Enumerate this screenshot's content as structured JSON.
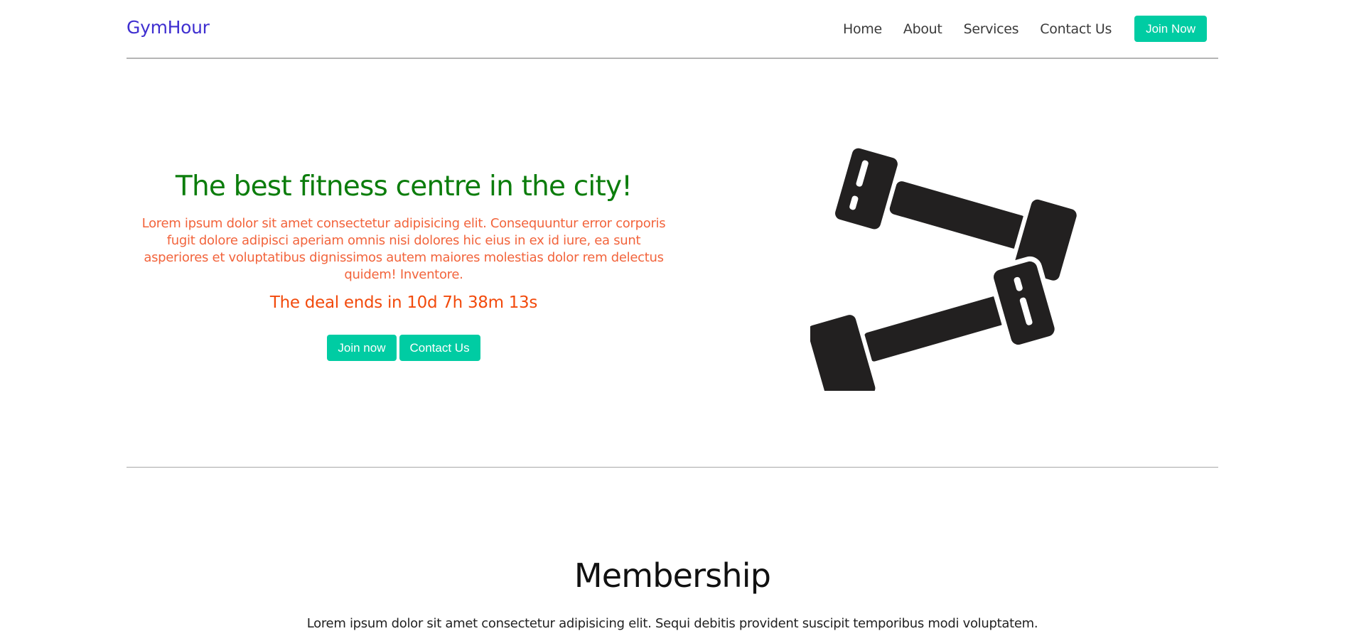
{
  "navbar": {
    "brand": "GymHour",
    "links": [
      "Home",
      "About",
      "Services",
      "Contact Us"
    ],
    "join_label": "Join Now"
  },
  "hero": {
    "title": "The best fitness centre in the city!",
    "description": "Lorem ipsum dolor sit amet consectetur adipisicing elit. Consequuntur error corporis fugit dolore adipisci aperiam omnis nisi dolores hic eius in ex id iure, ea sunt asperiores et voluptatibus dignissimos autem maiores molestias dolor rem delectus quidem! Inventore.",
    "deal_text": "The deal ends in 10d 7h 38m 13s",
    "join_button": "Join now",
    "contact_button": "Contact Us",
    "image": "dumbbells-icon"
  },
  "membership": {
    "title": "Membership",
    "description": "Lorem ipsum dolor sit amet consectetur adipisicing elit. Sequi debitis provident suscipit temporibus modi voluptatem."
  },
  "colors": {
    "brand": "#3f2fd0",
    "accent": "#00cca3",
    "title_green": "#0c7d0c",
    "desc_orange": "#f2643c",
    "deal_red": "#f24a0c"
  }
}
